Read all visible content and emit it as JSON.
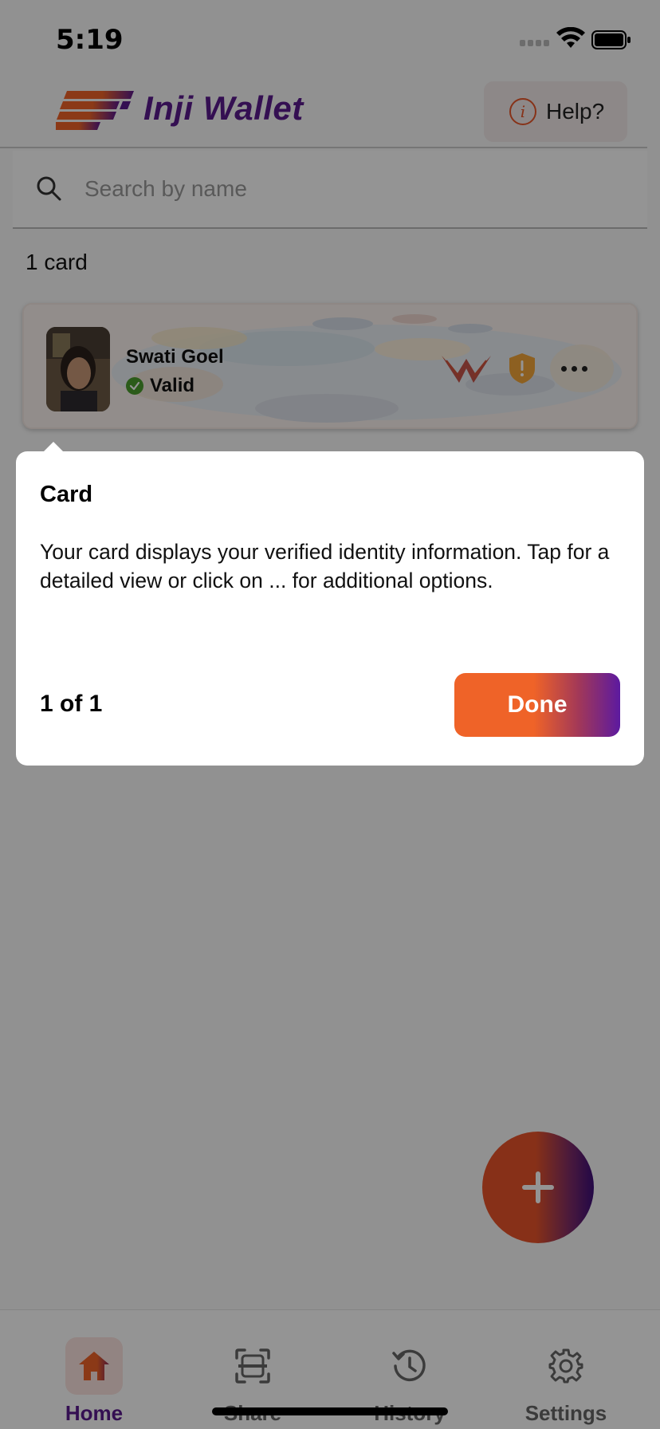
{
  "status_bar": {
    "time": "5:19"
  },
  "header": {
    "app_name": "Inji Wallet",
    "help_label": "Help?"
  },
  "search": {
    "placeholder": "Search by name",
    "value": ""
  },
  "card_count": "1 card",
  "card": {
    "name": "Swati Goel",
    "status": "Valid",
    "status_color": "#4a9d2e"
  },
  "tooltip": {
    "title": "Card",
    "body": "Your card displays your verified identity information. Tap for a detailed view or click on ... for additional options.",
    "step": "1 of 1",
    "done_label": "Done"
  },
  "fab": {
    "icon": "plus-icon"
  },
  "bottom_nav": {
    "items": [
      {
        "label": "Home",
        "icon": "home-icon",
        "active": true
      },
      {
        "label": "Share",
        "icon": "scan-icon",
        "active": false
      },
      {
        "label": "History",
        "icon": "history-icon",
        "active": false
      },
      {
        "label": "Settings",
        "icon": "gear-icon",
        "active": false
      }
    ]
  },
  "colors": {
    "brand_purple": "#5b1a8e",
    "brand_orange": "#ef6328",
    "accent_gradient_end": "#5c1aa0"
  }
}
